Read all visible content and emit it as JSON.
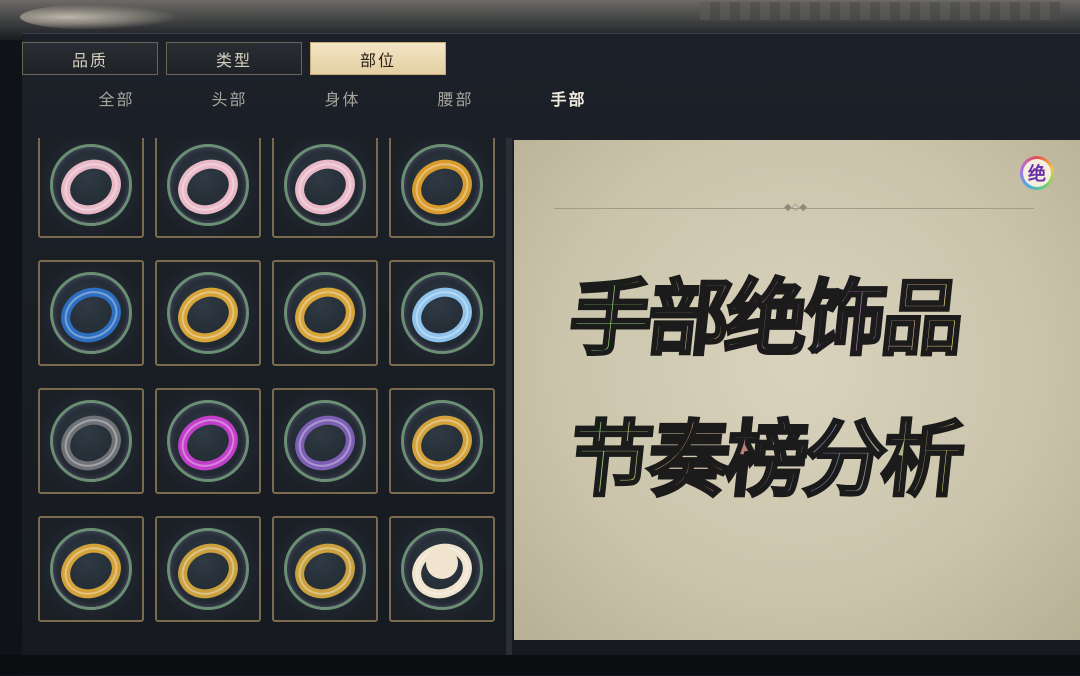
{
  "filter_tabs": [
    {
      "label": "品质",
      "active": false
    },
    {
      "label": "类型",
      "active": false
    },
    {
      "label": "部位",
      "active": true
    }
  ],
  "sub_tabs": [
    {
      "label": "全部",
      "active": false
    },
    {
      "label": "头部",
      "active": false
    },
    {
      "label": "身体",
      "active": false
    },
    {
      "label": "腰部",
      "active": false
    },
    {
      "label": "手部",
      "active": true
    }
  ],
  "items": [
    {
      "icon": "pink-ring-icon",
      "color": "#e9b9c8"
    },
    {
      "icon": "pink-ring-icon",
      "color": "#e9b9c8"
    },
    {
      "icon": "pink-ring-icon",
      "color": "#e9b9c8"
    },
    {
      "icon": "gold-ornate-ring-icon",
      "color": "#d99b2b"
    },
    {
      "icon": "blue-pixiu-ring-icon",
      "color": "#2e6fc2"
    },
    {
      "icon": "gold-dragon-ring-icon",
      "color": "#d7a53a"
    },
    {
      "icon": "gold-dragon-ring-icon",
      "color": "#d7a53a"
    },
    {
      "icon": "ice-blue-ring-icon",
      "color": "#8fc3ec"
    },
    {
      "icon": "swan-ring-icon",
      "color": "#6f7276"
    },
    {
      "icon": "magenta-ring-icon",
      "color": "#c23fc9"
    },
    {
      "icon": "purple-snake-ring-icon",
      "color": "#7d5fb4"
    },
    {
      "icon": "gold-phoenix-ring-icon",
      "color": "#d4a23a"
    },
    {
      "icon": "gold-phoenix-ring-icon",
      "color": "#d4a23a"
    },
    {
      "icon": "gold-coil-ring-icon",
      "color": "#caa13e"
    },
    {
      "icon": "gold-coil-ring-icon",
      "color": "#caa13e"
    },
    {
      "icon": "pearl-lotus-ring-icon",
      "color": "#f0e4cf"
    }
  ],
  "detail": {
    "badge": "绝",
    "headline_line1": "手部绝饰品",
    "headline_line2": "节奏榜分析"
  }
}
